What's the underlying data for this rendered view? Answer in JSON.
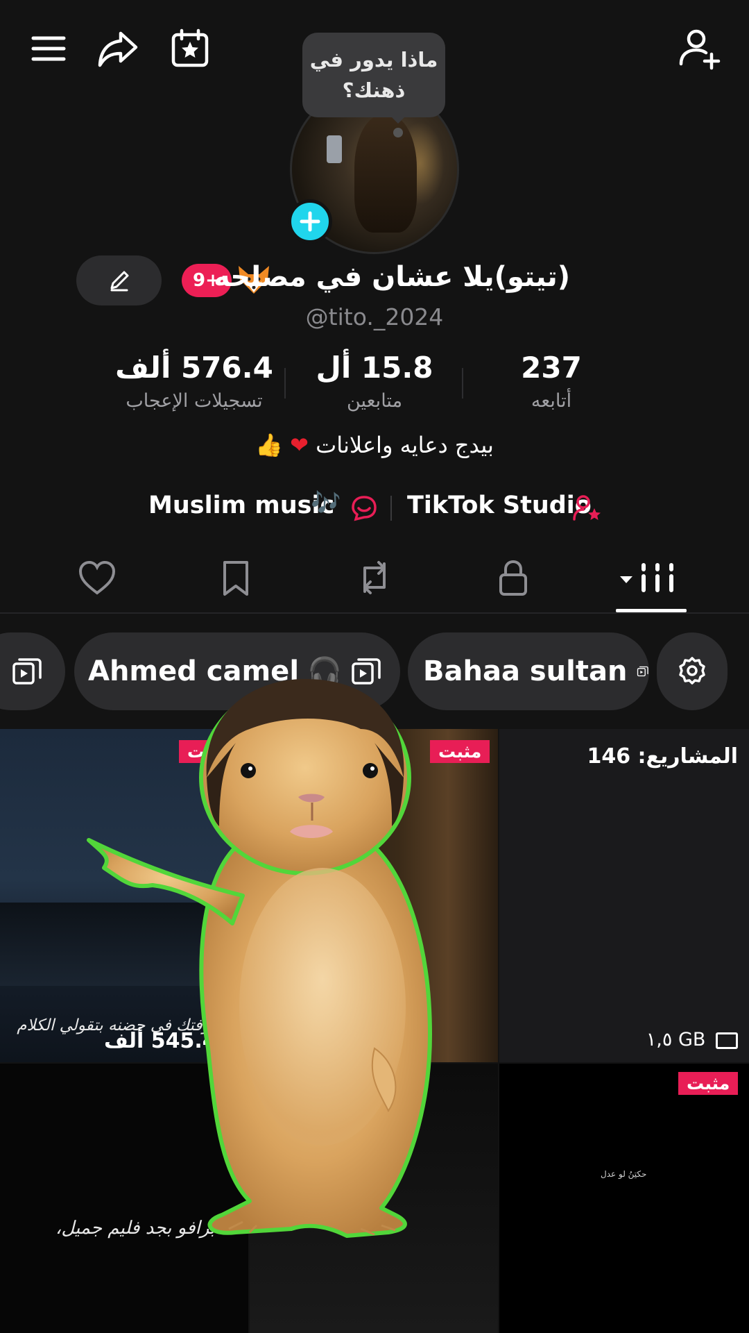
{
  "status_bubble": {
    "line1": "ماذا يدور في",
    "line2": "ذهنك؟"
  },
  "profile": {
    "display_name": "(تيتو)يلا عشان في مصلحه",
    "username": "@tito._2024",
    "notification_badge": "9+",
    "bio": "بيدج دعايه واعلانات"
  },
  "stats": [
    {
      "value": "576.4 ألف",
      "label": "تسجيلات الإعجاب"
    },
    {
      "value": "15.8 أل",
      "label": "متابعين"
    },
    {
      "value": "237",
      "label": "أتابعه"
    }
  ],
  "links": {
    "left": "Muslim music",
    "right": "TikTok Studio"
  },
  "collections": [
    {
      "label": "Ahmed camel"
    },
    {
      "label": "Bahaa sultan"
    }
  ],
  "grid": {
    "pinned_label": "مثبت",
    "video1_caption": "وشوفتك في حضنه بتقولي الكلام",
    "video1_views": "545.4 ألف",
    "drafts_label": "المشاريع: 146",
    "drafts_size": "١,٥ GB",
    "video3_caption": "برافو بجد فليم جميل،",
    "video4_caption": "حكتِنُ لو عدل"
  },
  "colors": {
    "accent": "#e81e56",
    "cyan": "#20d5ec",
    "background": "#131313"
  }
}
